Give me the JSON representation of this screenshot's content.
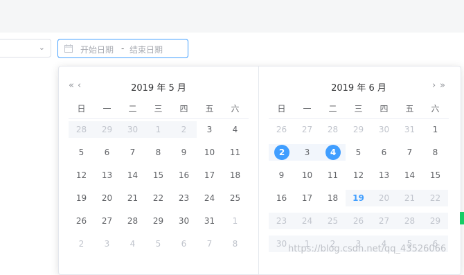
{
  "range_input": {
    "icon": "calendar-icon",
    "start_placeholder": "开始日期",
    "separator": "-",
    "end_placeholder": "结束日期"
  },
  "select": {
    "icon": "chevron-down-icon"
  },
  "nav": {
    "prev_year": "«",
    "prev_month": "‹",
    "next_month": "›",
    "next_year": "»"
  },
  "weekdays": [
    "日",
    "一",
    "二",
    "三",
    "四",
    "五",
    "六"
  ],
  "left_panel": {
    "title": "2019 年 5 月",
    "days": [
      [
        "28",
        "29",
        "30",
        "1",
        "2",
        "3",
        "4"
      ],
      [
        "5",
        "6",
        "7",
        "8",
        "9",
        "10",
        "11"
      ],
      [
        "12",
        "13",
        "14",
        "15",
        "16",
        "17",
        "18"
      ],
      [
        "19",
        "20",
        "21",
        "22",
        "23",
        "24",
        "25"
      ],
      [
        "26",
        "27",
        "28",
        "29",
        "30",
        "31",
        "1"
      ],
      [
        "2",
        "3",
        "4",
        "5",
        "6",
        "7",
        "8"
      ]
    ]
  },
  "right_panel": {
    "title": "2019 年 6 月",
    "days": [
      [
        "26",
        "27",
        "28",
        "29",
        "30",
        "31",
        "1"
      ],
      [
        "2",
        "3",
        "4",
        "5",
        "6",
        "7",
        "8"
      ],
      [
        "9",
        "10",
        "11",
        "12",
        "13",
        "14",
        "15"
      ],
      [
        "16",
        "17",
        "18",
        "19",
        "20",
        "21",
        "22"
      ],
      [
        "23",
        "24",
        "25",
        "26",
        "27",
        "28",
        "29"
      ],
      [
        "30",
        "1",
        "2",
        "3",
        "4",
        "5",
        "6"
      ]
    ]
  },
  "watermark": "https://blog.csdn.net/qq_43526066",
  "colors": {
    "accent": "#409eff",
    "muted": "#c0c4cc",
    "range": "#f2f6fc",
    "disabled_bg": "#f5f7fa"
  }
}
